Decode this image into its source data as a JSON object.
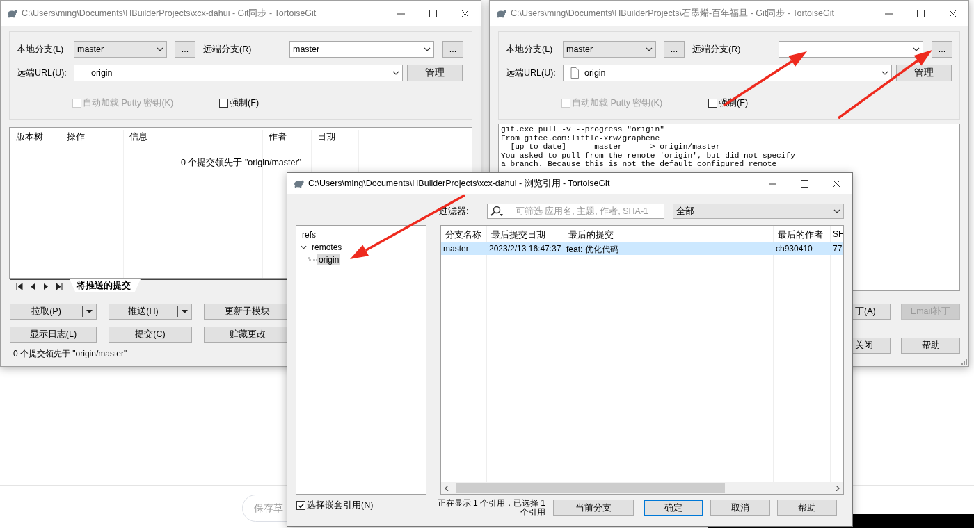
{
  "page": {
    "save_draft_button": "保存草"
  },
  "left_window": {
    "title": "C:\\Users\\ming\\Documents\\HBuilderProjects\\xcx-dahui - Git同步 - TortoiseGit",
    "active": false,
    "local_branch_label": "本地分支(L)",
    "local_branch": "master",
    "browse_local": "...",
    "remote_branch_label": "远端分支(R)",
    "remote_branch": "master",
    "browse_remote": "...",
    "url_label": "远端URL(U):",
    "url": "origin",
    "url_file_icon": false,
    "manage": "管理",
    "autoload_putty": {
      "label": "自动加载 Putty 密钥(K)",
      "checked": false,
      "disabled": true
    },
    "force": {
      "label": "强制(F)",
      "checked": false,
      "disabled": false
    },
    "commits_table": {
      "columns": [
        "版本树",
        "操作",
        "信息",
        "作者",
        "日期"
      ],
      "message": "0 个提交领先于 \"origin/master\""
    },
    "tabs": [
      {
        "label": "将推送的提交",
        "selected": true
      }
    ],
    "buttons": [
      {
        "label": "拉取(P)",
        "split": true
      },
      {
        "label": "推送(H)",
        "split": true
      },
      {
        "label": "更新子模块",
        "split": false
      },
      {
        "label": "显示日志(L)",
        "split": false
      },
      {
        "label": "提交(C)",
        "split": false
      },
      {
        "label": "贮藏更改",
        "split": false
      }
    ],
    "status": "0 个提交领先于 \"origin/master\""
  },
  "right_window": {
    "title": "C:\\Users\\ming\\Documents\\HBuilderProjects\\石墨烯-百年福旦 - Git同步 - TortoiseGit",
    "active": false,
    "local_branch_label": "本地分支(L)",
    "local_branch": "master",
    "browse_local": "...",
    "remote_branch_label": "远端分支(R)",
    "browse_remote": "...",
    "url_label": "远端URL(U):",
    "url": "origin",
    "url_file_icon": true,
    "manage": "管理",
    "autoload_putty": {
      "label": "自动加载 Putty 密钥(K)",
      "checked": false,
      "disabled": true
    },
    "force": {
      "label": "强制(F)",
      "checked": false,
      "disabled": false
    },
    "log": [
      "git.exe pull -v --progress \"origin\"",
      "From gitee.com:little-xrw/graphene",
      "= [up to date]      master     -> origin/master",
      "You asked to pull from the remote 'origin', but did not specify",
      "a branch. Because this is not the default configured remote"
    ],
    "buttons": [
      {
        "label": "丁(A)",
        "disabled": false
      },
      {
        "label": "Email补丁",
        "disabled": true
      },
      {
        "label": "关闭",
        "disabled": false
      },
      {
        "label": "帮助",
        "disabled": false
      }
    ]
  },
  "browse_refs_dialog": {
    "title": "C:\\Users\\ming\\Documents\\HBuilderProjects\\xcx-dahui - 浏览引用 - TortoiseGit",
    "active": true,
    "filter": {
      "label": "过滤器:",
      "placeholder": "可筛选 应用名, 主题, 作者, SHA-1",
      "scope": "全部"
    },
    "tree": [
      {
        "label": "refs",
        "selected": false,
        "children": [
          {
            "label": "remotes",
            "expanded": true,
            "selected": false,
            "children": [
              {
                "label": "origin",
                "selected": true
              }
            ]
          }
        ]
      }
    ],
    "list": {
      "columns": [
        "分支名称",
        "最后提交日期",
        "最后的提交",
        "最后的作者",
        "SH"
      ],
      "rows": [
        {
          "cells": [
            "master",
            "2023/2/13 16:47:37",
            "feat: 优化代码",
            "ch930410",
            "77"
          ],
          "selected": true
        }
      ]
    },
    "nested_refs": {
      "label": "选择嵌套引用(N)",
      "checked": true
    },
    "status": "正在显示 1 个引用，已选择 1 个引用",
    "buttons": [
      {
        "label": "当前分支",
        "default": false
      },
      {
        "label": "确定",
        "default": true
      },
      {
        "label": "取消",
        "default": false
      },
      {
        "label": "帮助",
        "default": false
      }
    ]
  }
}
